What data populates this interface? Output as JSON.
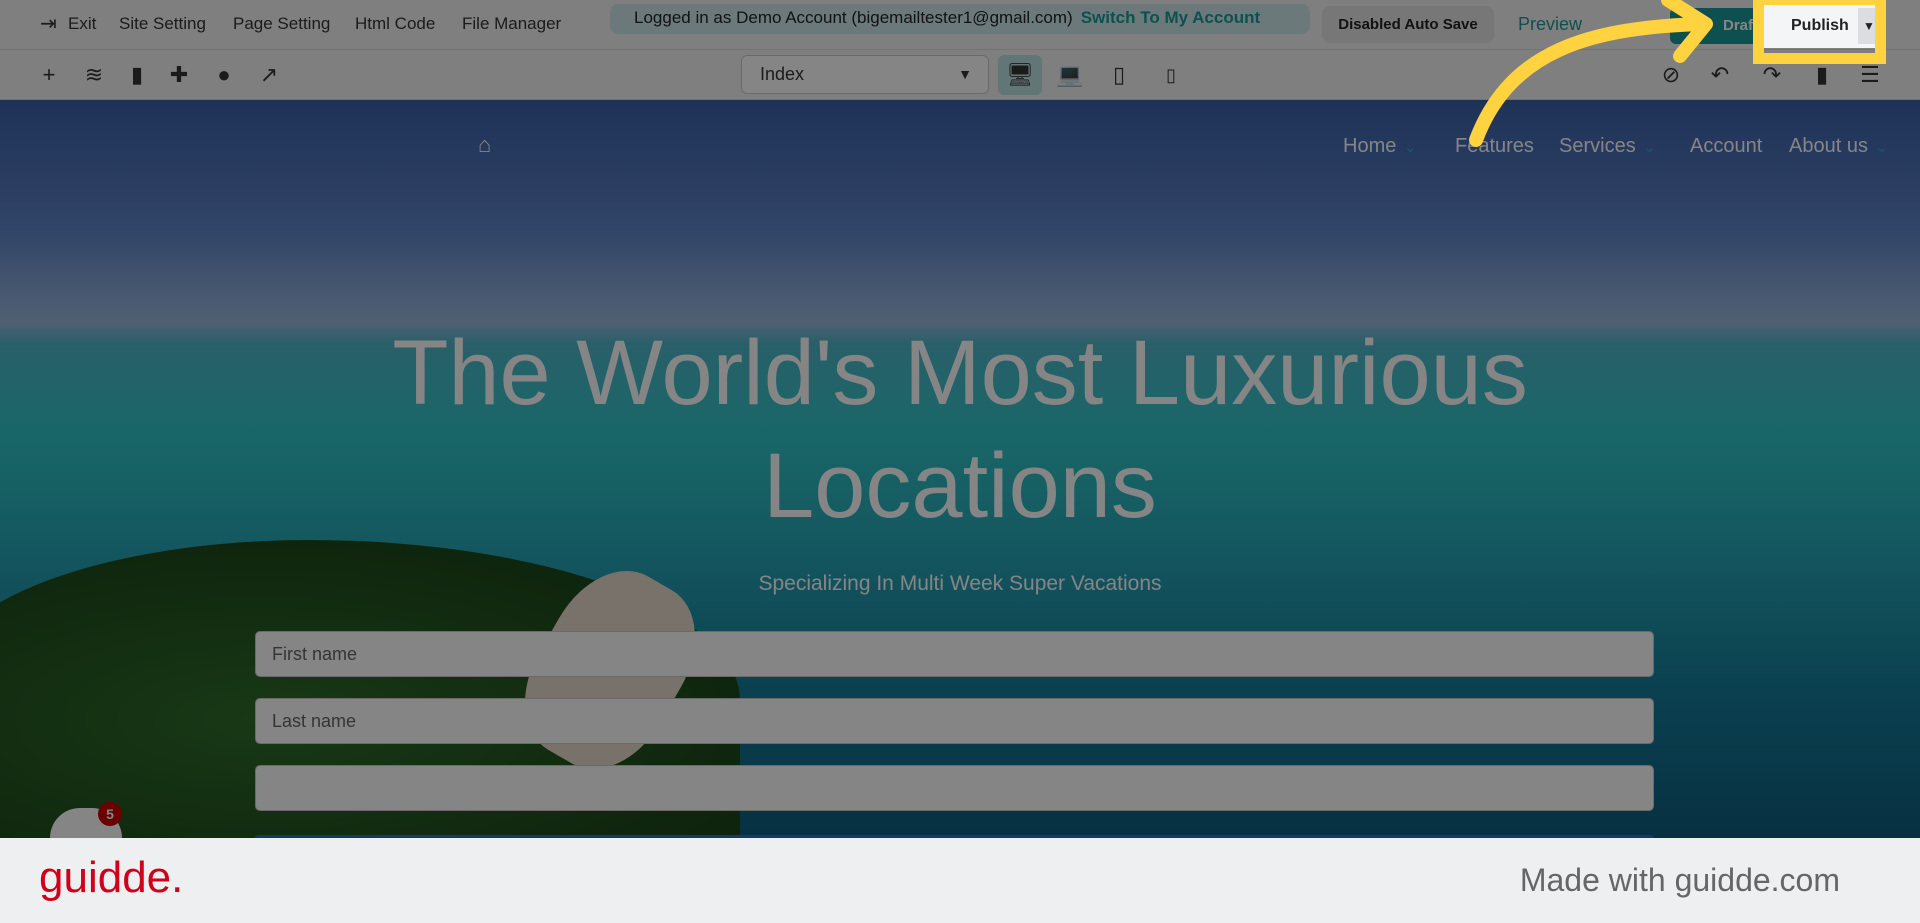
{
  "topbar": {
    "menu": [
      "Exit",
      "Site Setting",
      "Page Setting",
      "Html Code",
      "File Manager"
    ],
    "logged_in": "Logged in as Demo Account (bigemailtester1@gmail.com)",
    "switch": "Switch To My Account",
    "autosave": "Disabled Auto Save",
    "preview": "Preview",
    "draft": "Draft",
    "publish": "Publish"
  },
  "toolbar": {
    "page_select": "Index",
    "tools": [
      "add-icon",
      "layers-icon",
      "page-icon",
      "puzzle-icon",
      "palette-icon",
      "external-link-icon"
    ],
    "devices": [
      "desktop",
      "laptop",
      "tablet",
      "mobile"
    ],
    "active_device": "desktop"
  },
  "site": {
    "nav": [
      "Home",
      "Features",
      "Services",
      "Account",
      "About us"
    ],
    "heading_line1": "The World's Most Luxurious",
    "heading_line2": "Locations",
    "subtitle": "Specializing In Multi Week Super Vacations",
    "first_name_placeholder": "First name",
    "last_name_placeholder": "Last name"
  },
  "chat": {
    "badge": "5"
  },
  "footer": {
    "logo": "guidde.",
    "made_with": "Made with guidde.com"
  },
  "colors": {
    "accent": "#1a9a9a",
    "highlight": "#ffd23f",
    "brand": "#d0021b"
  }
}
